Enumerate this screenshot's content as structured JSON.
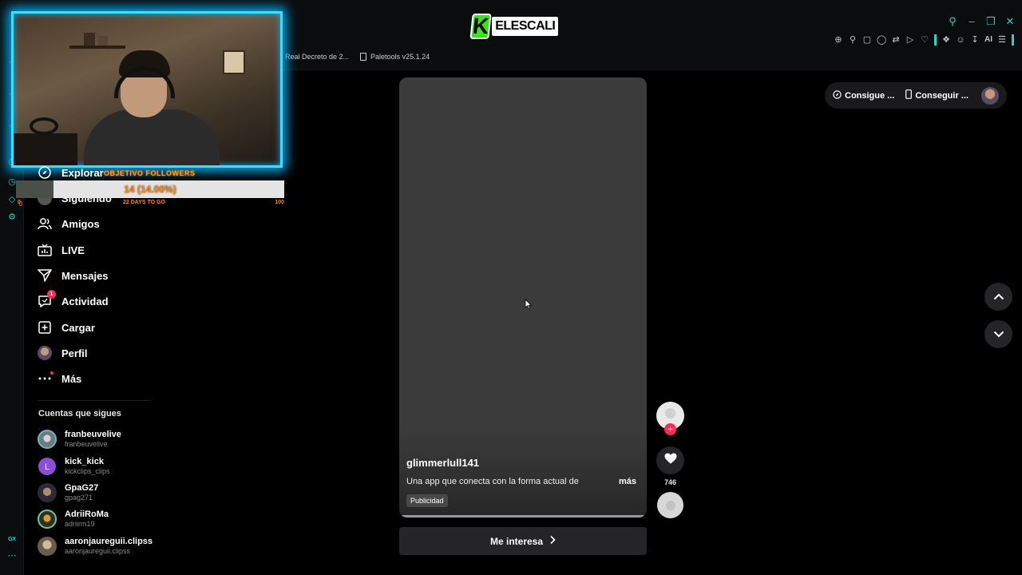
{
  "browser": {
    "channel_logo": {
      "k": "K",
      "name": "ELESCALI"
    },
    "bookmarks": [
      "Real Decreto de 2...",
      "Paletools v25.1.24"
    ],
    "toolbar_ai_label": "AI",
    "rail_gx_label": "GX",
    "rail_badge": "0"
  },
  "stream_overlay": {
    "goal_title": "OBJETIVO FOLLOWERS",
    "goal_count": "14 (14.00%)",
    "goal_progress_percent": 14,
    "goal_subtitle": "22 DAYS TO GO",
    "goal_min": "0",
    "goal_max": "100"
  },
  "nav": {
    "items": [
      {
        "label": "Explorar",
        "icon": "compass-icon"
      },
      {
        "label": "Siguiendo",
        "icon": "following-avatar-icon"
      },
      {
        "label": "Amigos",
        "icon": "friends-icon"
      },
      {
        "label": "LIVE",
        "icon": "live-tv-icon"
      },
      {
        "label": "Mensajes",
        "icon": "send-icon"
      },
      {
        "label": "Actividad",
        "icon": "activity-icon",
        "badge": "1"
      },
      {
        "label": "Cargar",
        "icon": "upload-plus-icon"
      },
      {
        "label": "Perfil",
        "icon": "profile-avatar-icon"
      },
      {
        "label": "Más",
        "icon": "more-dots-icon"
      }
    ]
  },
  "following": {
    "heading": "Cuentas que sigues",
    "accounts": [
      {
        "name": "franbeuvelive",
        "handle": "franbeuvelive",
        "color": "#7a8c96"
      },
      {
        "name": "kick_kick",
        "handle": "kickclips_clips",
        "color": "#8b4fd6",
        "initial": "L"
      },
      {
        "name": "GpaG27",
        "handle": "gpag271",
        "color": "#3a3a4a"
      },
      {
        "name": "AdriiRoMa",
        "handle": "adriirm19",
        "color": "#8a6a2a"
      },
      {
        "name": "aaronjaureguii.clipss",
        "handle": "aaronjaureguii.clipss",
        "color": "#b9a89a"
      }
    ]
  },
  "video": {
    "author": "glimmerlull141",
    "description": "Una app que conecta con la forma actual de",
    "more_label": "más",
    "tag": "Publicidad",
    "cta_label": "Me interesa",
    "like_count": "746"
  },
  "header_actions": {
    "coins_label": "Consigue ...",
    "app_label": "Conseguir ..."
  },
  "colors": {
    "accent": "#fe2c55",
    "opera_gx": "#2ad3c4",
    "webcam_border": "#3fdcff",
    "goal_text": "#f48a1e"
  }
}
